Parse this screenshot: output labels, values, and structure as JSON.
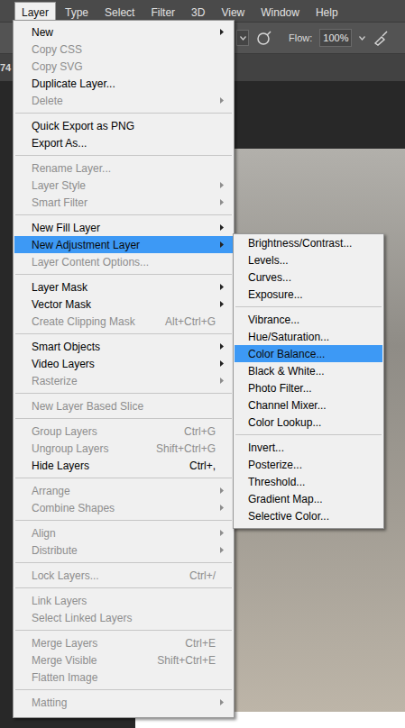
{
  "menubar": [
    {
      "label": "Layer",
      "selected": true
    },
    {
      "label": "Type",
      "selected": false
    },
    {
      "label": "Select",
      "selected": false
    },
    {
      "label": "Filter",
      "selected": false
    },
    {
      "label": "3D",
      "selected": false
    },
    {
      "label": "View",
      "selected": false
    },
    {
      "label": "Window",
      "selected": false
    },
    {
      "label": "Help",
      "selected": false
    }
  ],
  "options_bar": {
    "flow_label": "Flow:",
    "flow_value": "100%"
  },
  "document_tab": {
    "title": "74"
  },
  "menu": {
    "items": [
      {
        "kind": "item",
        "label": "New",
        "disabled": false,
        "selected": false,
        "submenu": true
      },
      {
        "kind": "item",
        "label": "Copy CSS",
        "disabled": true,
        "selected": false,
        "submenu": false
      },
      {
        "kind": "item",
        "label": "Copy SVG",
        "disabled": true,
        "selected": false,
        "submenu": false
      },
      {
        "kind": "item",
        "label": "Duplicate Layer...",
        "disabled": false,
        "selected": false,
        "submenu": false
      },
      {
        "kind": "item",
        "label": "Delete",
        "disabled": true,
        "selected": false,
        "submenu": true
      },
      {
        "kind": "separator"
      },
      {
        "kind": "item",
        "label": "Quick Export as PNG",
        "disabled": false,
        "selected": false,
        "submenu": false
      },
      {
        "kind": "item",
        "label": "Export As...",
        "disabled": false,
        "selected": false,
        "submenu": false
      },
      {
        "kind": "separator"
      },
      {
        "kind": "item",
        "label": "Rename Layer...",
        "disabled": true,
        "selected": false,
        "submenu": false
      },
      {
        "kind": "item",
        "label": "Layer Style",
        "disabled": true,
        "selected": false,
        "submenu": true
      },
      {
        "kind": "item",
        "label": "Smart Filter",
        "disabled": true,
        "selected": false,
        "submenu": true
      },
      {
        "kind": "separator"
      },
      {
        "kind": "item",
        "label": "New Fill Layer",
        "disabled": false,
        "selected": false,
        "submenu": true
      },
      {
        "kind": "item",
        "label": "New Adjustment Layer",
        "disabled": false,
        "selected": true,
        "submenu": true
      },
      {
        "kind": "item",
        "label": "Layer Content Options...",
        "disabled": true,
        "selected": false,
        "submenu": false
      },
      {
        "kind": "separator"
      },
      {
        "kind": "item",
        "label": "Layer Mask",
        "disabled": false,
        "selected": false,
        "submenu": true
      },
      {
        "kind": "item",
        "label": "Vector Mask",
        "disabled": false,
        "selected": false,
        "submenu": true
      },
      {
        "kind": "item",
        "label": "Create Clipping Mask",
        "disabled": true,
        "selected": false,
        "submenu": false,
        "shortcut": "Alt+Ctrl+G"
      },
      {
        "kind": "separator"
      },
      {
        "kind": "item",
        "label": "Smart Objects",
        "disabled": false,
        "selected": false,
        "submenu": true
      },
      {
        "kind": "item",
        "label": "Video Layers",
        "disabled": false,
        "selected": false,
        "submenu": true
      },
      {
        "kind": "item",
        "label": "Rasterize",
        "disabled": true,
        "selected": false,
        "submenu": true
      },
      {
        "kind": "separator"
      },
      {
        "kind": "item",
        "label": "New Layer Based Slice",
        "disabled": true,
        "selected": false,
        "submenu": false
      },
      {
        "kind": "separator"
      },
      {
        "kind": "item",
        "label": "Group Layers",
        "disabled": true,
        "selected": false,
        "submenu": false,
        "shortcut": "Ctrl+G"
      },
      {
        "kind": "item",
        "label": "Ungroup Layers",
        "disabled": true,
        "selected": false,
        "submenu": false,
        "shortcut": "Shift+Ctrl+G"
      },
      {
        "kind": "item",
        "label": "Hide Layers",
        "disabled": false,
        "selected": false,
        "submenu": false,
        "shortcut": "Ctrl+,"
      },
      {
        "kind": "separator"
      },
      {
        "kind": "item",
        "label": "Arrange",
        "disabled": true,
        "selected": false,
        "submenu": true
      },
      {
        "kind": "item",
        "label": "Combine Shapes",
        "disabled": true,
        "selected": false,
        "submenu": true
      },
      {
        "kind": "separator"
      },
      {
        "kind": "item",
        "label": "Align",
        "disabled": true,
        "selected": false,
        "submenu": true
      },
      {
        "kind": "item",
        "label": "Distribute",
        "disabled": true,
        "selected": false,
        "submenu": true
      },
      {
        "kind": "separator"
      },
      {
        "kind": "item",
        "label": "Lock Layers...",
        "disabled": true,
        "selected": false,
        "submenu": false,
        "shortcut": "Ctrl+/"
      },
      {
        "kind": "separator"
      },
      {
        "kind": "item",
        "label": "Link Layers",
        "disabled": true,
        "selected": false,
        "submenu": false
      },
      {
        "kind": "item",
        "label": "Select Linked Layers",
        "disabled": true,
        "selected": false,
        "submenu": false
      },
      {
        "kind": "separator"
      },
      {
        "kind": "item",
        "label": "Merge Layers",
        "disabled": true,
        "selected": false,
        "submenu": false,
        "shortcut": "Ctrl+E"
      },
      {
        "kind": "item",
        "label": "Merge Visible",
        "disabled": true,
        "selected": false,
        "submenu": false,
        "shortcut": "Shift+Ctrl+E"
      },
      {
        "kind": "item",
        "label": "Flatten Image",
        "disabled": true,
        "selected": false,
        "submenu": false
      },
      {
        "kind": "separator"
      },
      {
        "kind": "item",
        "label": "Matting",
        "disabled": true,
        "selected": false,
        "submenu": true
      }
    ]
  },
  "submenu": {
    "items": [
      {
        "kind": "item",
        "label": "Brightness/Contrast...",
        "selected": false
      },
      {
        "kind": "item",
        "label": "Levels...",
        "selected": false
      },
      {
        "kind": "item",
        "label": "Curves...",
        "selected": false
      },
      {
        "kind": "item",
        "label": "Exposure...",
        "selected": false
      },
      {
        "kind": "separator"
      },
      {
        "kind": "item",
        "label": "Vibrance...",
        "selected": false
      },
      {
        "kind": "item",
        "label": "Hue/Saturation...",
        "selected": false
      },
      {
        "kind": "item",
        "label": "Color Balance...",
        "selected": true
      },
      {
        "kind": "item",
        "label": "Black & White...",
        "selected": false
      },
      {
        "kind": "item",
        "label": "Photo Filter...",
        "selected": false
      },
      {
        "kind": "item",
        "label": "Channel Mixer...",
        "selected": false
      },
      {
        "kind": "item",
        "label": "Color Lookup...",
        "selected": false
      },
      {
        "kind": "separator"
      },
      {
        "kind": "item",
        "label": "Invert...",
        "selected": false
      },
      {
        "kind": "item",
        "label": "Posterize...",
        "selected": false
      },
      {
        "kind": "item",
        "label": "Threshold...",
        "selected": false
      },
      {
        "kind": "item",
        "label": "Gradient Map...",
        "selected": false
      },
      {
        "kind": "item",
        "label": "Selective Color...",
        "selected": false
      }
    ]
  }
}
